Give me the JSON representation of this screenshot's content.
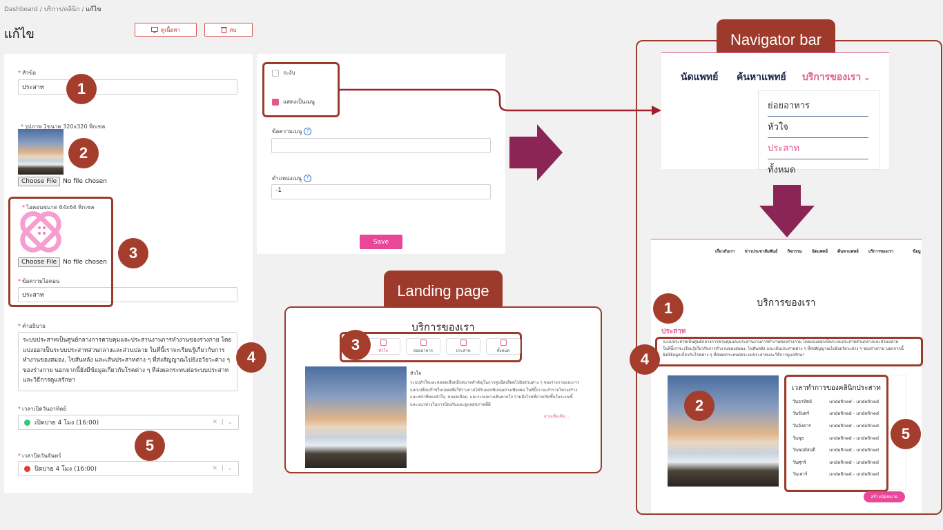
{
  "breadcrumb": {
    "items": [
      "Dashboard",
      "บริการ/คลินิก"
    ],
    "current": "แก้ไข"
  },
  "page_title": "แก้ไข",
  "header_buttons": {
    "view_label": "ดูเนื้อหา",
    "delete_label": "ลบ"
  },
  "form": {
    "title_label": "หัวข้อ",
    "title_value": "ประสาท",
    "image_label": "รูปภาพ 1ขนาด 320x320 พิกเซล",
    "file_button": "Choose File",
    "file_status": "No file chosen",
    "icon_label": "ไอคอนขนาด 64x64 พิกเซล",
    "icon_text_label": "ข้อความไอคอน",
    "icon_text_value": "ประสาท",
    "desc_label": "คำอธิบาย",
    "desc_value": "ระบบประสาทเป็นศูนย์กลางการควบคุมและประสานงานการทำงานของร่างกาย โดยแบ่งออกเป็นระบบประสาทส่วนกลางและส่วนปลาย ในที่นี้เราจะเรียนรู้เกี่ยวกับการทำงานของสมอง, ไขสันหลัง และเส้นประสาทต่าง ๆ ที่ส่งสัญญาณไปยังอวัยวะต่าง ๆ ของร่างกาย นอกจากนี้ยังมีข้อมูลเกี่ยวกับโรคต่าง ๆ ที่ส่งผลกระทบต่อระบบประสาทและวิธีการดูแลรักษา",
    "sunday_close_label": "เวลาเปิดวันอาทิตย์",
    "sunday_close_value": "เปิดบ่าย 4 โมง (16:00)",
    "monday_close_label": "เวลาปิดวันจันทร์",
    "monday_close_value": "ปิดบ่าย 4 โมง (16:00)",
    "suspend_label": "ระงับ",
    "show_menu_label": "แสดงเป็นเมนู",
    "menu_text_label": "ข้อความเมนู",
    "menu_text_value": "",
    "menu_position_label": "ตำแหน่งเมนู",
    "menu_position_value": "-1",
    "save_label": "Save"
  },
  "colors": {
    "accent": "#e9479a",
    "callout": "#9e3a2b",
    "green": "#2ecc71",
    "red": "#e53935"
  },
  "annotations": {
    "navigator_callout": "Navigator bar",
    "landing_callout": "Landing page",
    "numbers": [
      "1",
      "2",
      "3",
      "4",
      "5"
    ]
  },
  "landing": {
    "heading": "บริการของเรา",
    "tabs": [
      "หัวใจ",
      "ย่อยอาหาร",
      "ประสาท",
      "ทั้งหมด"
    ],
    "article_title": "หัวใจ",
    "article_text": "ระบบหัวใจและหลอดเลือดมีบทบาทสำคัญในการสูบฉีดเลือดไปยังส่วนต่าง ๆ ของร่างกายและการแลกเปลี่ยนก๊าซในปอดเพื่อให้ร่างกายได้รับออกซิเจนอย่างเพียงพอ ในที่นี้เราจะสำรวจโครงสร้างและหน้าที่ของหัวใจ, หลอดเลือด, และระบบทางเดินหายใจ รวมถึงโรคที่อาจเกิดขึ้นในระบบนี้และแนวทางในการป้องกันและดูแลสุขภาพที่ดี",
    "read_more": "อ่านเพิ่มเติม..."
  },
  "navigator": {
    "items": [
      "นัดแพทย์",
      "ค้นหาแพทย์",
      "บริการของเรา"
    ],
    "dropdown": [
      "ย่อยอาหาร",
      "หัวใจ",
      "ประสาท",
      "ทั้งหมด"
    ]
  },
  "result_page": {
    "nav_items": [
      "เกี่ยวกับเรา",
      "ข่าวประชาสัมพันธ์",
      "กิจกรรม",
      "นัดแพทย์",
      "ค้นหาแพทย์",
      "บริการของเรา",
      "ข้อมู"
    ],
    "heading": "บริการของเรา",
    "section_title": "ประสาท",
    "section_text": "ระบบประสาทเป็นศูนย์กลางการควบคุมและประสานงานการทำงานของร่างกาย โดยแบ่งออกเป็นระบบประสาทส่วนกลางและส่วนปลาย ในที่นี้เราจะเรียนรู้เกี่ยวกับการทำงานของสมอง, ไขสันหลัง และเส้นประสาทต่าง ๆ ที่ส่งสัญญาณไปยังอวัยวะต่าง ๆ ของร่างกาย นอกจากนี้ยังมีข้อมูลเกี่ยวกับโรคต่าง ๆ ที่ส่งผลกระทบต่อระบบประสาทและวิธีการดูแลรักษา",
    "schedule_title": "เวลาทำการของคลินิกประสาท",
    "schedule": [
      {
        "day": "วันอาทิตย์",
        "time": "undefined - undefined"
      },
      {
        "day": "วันจันทร์",
        "time": "undefined - undefined"
      },
      {
        "day": "วันอังคาร",
        "time": "undefined - undefined"
      },
      {
        "day": "วันพุธ",
        "time": "undefined - undefined"
      },
      {
        "day": "วันพฤหัสบดี",
        "time": "undefined - undefined"
      },
      {
        "day": "วันศุกร์",
        "time": "undefined - undefined"
      },
      {
        "day": "วันเสาร์",
        "time": "undefined - undefined"
      }
    ],
    "appointment_button": "สร้างนัดหมาย"
  }
}
